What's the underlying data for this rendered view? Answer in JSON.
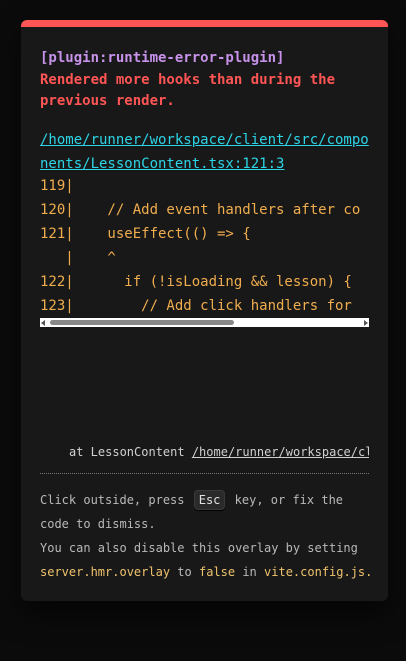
{
  "overlay": {
    "accent_color": "#ff5555",
    "plugin": "[plugin:runtime-error-plugin]",
    "message": "Rendered more hooks than during the previous render.",
    "file_link": "/home/runner/workspace/client/src/components/LessonContent.tsx:121:3",
    "frame_lines": [
      "119|",
      "120|    // Add event handlers after co",
      "121|    useEffect(() => {",
      "   |    ^",
      "122|      if (!isLoading && lesson) {",
      "123|        // Add click handlers for"
    ],
    "stack": {
      "prefix": "at LessonContent",
      "path": "/home/runner/workspace/cl"
    },
    "tip": {
      "part1": "Click outside, press",
      "key": "Esc",
      "part2": "key, or fix the code to dismiss.",
      "line2_part1": "You can also disable this overlay by setting",
      "setting": "server.hmr.overlay",
      "line2_part2": "to",
      "value": "false",
      "line2_part3": "in",
      "file": "vite.config.js."
    }
  }
}
